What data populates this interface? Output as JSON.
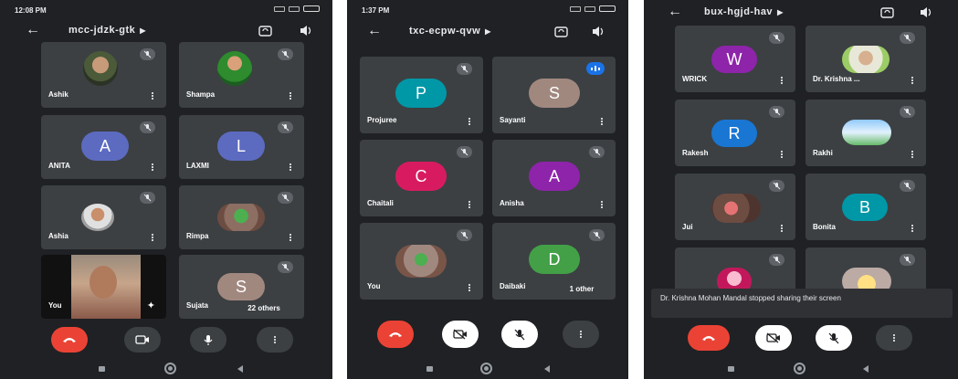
{
  "screens": [
    {
      "time": "12:08 PM",
      "meeting_code": "mcc-jdzk-gtk",
      "participants": [
        {
          "name": "Ashik"
        },
        {
          "name": "Shampa"
        },
        {
          "name": "ANITA",
          "initial": "A"
        },
        {
          "name": "LAXMI",
          "initial": "L"
        },
        {
          "name": "Ashia"
        },
        {
          "name": "Rimpa"
        },
        {
          "name": "You"
        },
        {
          "name": "Sujata",
          "initial": "S"
        }
      ],
      "others_label": "22 others"
    },
    {
      "time": "1:37 PM",
      "meeting_code": "txc-ecpw-qvw",
      "participants": [
        {
          "name": "Projuree",
          "initial": "P"
        },
        {
          "name": "Sayanti",
          "initial": "S"
        },
        {
          "name": "Chaitali",
          "initial": "C"
        },
        {
          "name": "Anisha",
          "initial": "A"
        },
        {
          "name": "You"
        },
        {
          "name": "Daibaki",
          "initial": "D"
        }
      ],
      "others_label": "1 other"
    },
    {
      "meeting_code": "bux-hgjd-hav",
      "participants": [
        {
          "name": "WRICK",
          "initial": "W"
        },
        {
          "name": "Dr. Krishna ..."
        },
        {
          "name": "Rakesh",
          "initial": "R"
        },
        {
          "name": "Rakhi"
        },
        {
          "name": "Jui"
        },
        {
          "name": "Bonita",
          "initial": "B"
        }
      ],
      "toast": "Dr. Krishna Mohan Mandal stopped sharing their screen"
    }
  ],
  "icons": {
    "back": "arrow-back-icon",
    "switch_camera": "switch-camera-icon",
    "speaker": "speaker-icon",
    "mic_off": "mic-off-icon",
    "end_call": "end-call-icon",
    "camera": "camera-icon",
    "camera_off": "camera-off-icon",
    "mic": "mic-icon",
    "more": "more-vert-icon",
    "effects": "sparkle-icon",
    "audio_level": "audio-level-icon"
  },
  "colors": {
    "background": "#202124",
    "tile": "#3c4043",
    "end_call": "#ea4335",
    "avatar_A": "#5c6bc0",
    "avatar_L": "#5c6bc0",
    "avatar_S_brown": "#a1887f",
    "avatar_P": "#0097a7",
    "avatar_S2": "#a1887f",
    "avatar_C": "#d81b60",
    "avatar_A2": "#8e24aa",
    "avatar_D": "#43a047",
    "avatar_W": "#8e24aa",
    "avatar_R": "#1976d2",
    "avatar_B": "#0097a7"
  }
}
